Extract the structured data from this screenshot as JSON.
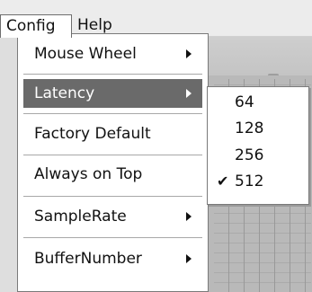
{
  "menubar": {
    "items": [
      {
        "label": "Config"
      },
      {
        "label": "Help"
      }
    ]
  },
  "config_menu": {
    "items": [
      {
        "label": "Mouse Wheel",
        "has_submenu": true
      },
      {
        "label": "Latency",
        "has_submenu": true,
        "highlighted": true
      },
      {
        "label": "Factory Default",
        "has_submenu": false
      },
      {
        "label": "Always on Top",
        "has_submenu": false
      },
      {
        "label": "SampleRate",
        "has_submenu": true
      },
      {
        "label": "BufferNumber",
        "has_submenu": true
      }
    ]
  },
  "latency_submenu": {
    "items": [
      {
        "label": "64",
        "checked": false
      },
      {
        "label": "128",
        "checked": false
      },
      {
        "label": "256",
        "checked": false
      },
      {
        "label": "512",
        "checked": true
      }
    ],
    "check_glyph": "✔"
  },
  "colors": {
    "highlight": "#6a6a6a",
    "menu_bg": "#ffffff",
    "menubar_bg": "#ececec"
  }
}
